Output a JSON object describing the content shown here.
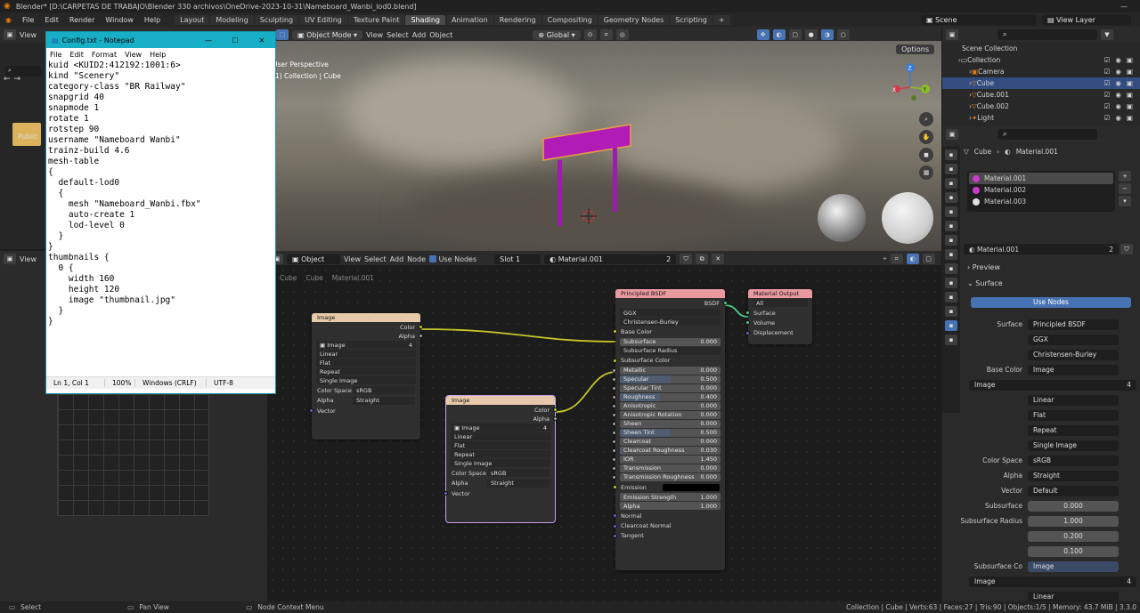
{
  "window_title": "Blender* [D:\\CARPETAS DE TRABAJO\\Blender 330 archivos\\OneDrive-2023-10-31\\Nameboard_Wanbi_lod0.blend]",
  "menu": [
    "File",
    "Edit",
    "Render",
    "Window",
    "Help"
  ],
  "workspaces": [
    "Layout",
    "Modeling",
    "Sculpting",
    "UV Editing",
    "Texture Paint",
    "Shading",
    "Animation",
    "Rendering",
    "Compositing",
    "Geometry Nodes",
    "Scripting",
    "+"
  ],
  "active_workspace": "Shading",
  "scene": "Scene",
  "view_layer": "View Layer",
  "viewport": {
    "mode": "Object Mode",
    "view": "View",
    "select": "Select",
    "add": "Add",
    "object": "Object",
    "orientation": "Global",
    "options": "Options",
    "info1": "User Perspective",
    "info2": "(1) Collection | Cube"
  },
  "gizmo": {
    "z": "Z",
    "y": "Y",
    "x": "X"
  },
  "left_panel": {
    "view": "View",
    "public": "Public"
  },
  "node_editor": {
    "type": "Object",
    "view": "View",
    "select": "Select",
    "add": "Add",
    "node": "Node",
    "use_nodes": "Use Nodes",
    "slot": "Slot 1",
    "material": "Material.001",
    "users": "2",
    "crumb1": "Cube",
    "crumb2": "Cube",
    "crumb3": "Material.001"
  },
  "node_image1": {
    "title": "Image",
    "out_color": "Color",
    "out_alpha": "Alpha",
    "img": "Image",
    "users": "4",
    "interp": "Linear",
    "proj": "Flat",
    "ext": "Repeat",
    "src": "Single Image",
    "cs_lbl": "Color Space",
    "cs": "sRGB",
    "alpha_lbl": "Alpha",
    "alpha": "Straight",
    "vector": "Vector"
  },
  "node_image2": {
    "title": "Image",
    "out_color": "Color",
    "out_alpha": "Alpha",
    "img": "Image",
    "users": "4",
    "interp": "Linear",
    "proj": "Flat",
    "ext": "Repeat",
    "src": "Single Image",
    "cs_lbl": "Color Space",
    "cs": "sRGB",
    "alpha_lbl": "Alpha",
    "alpha": "Straight",
    "vector": "Vector"
  },
  "bsdf": {
    "title": "Principled BSDF",
    "out": "BSDF",
    "dist": "GGX",
    "sss": "Christensen-Burley",
    "base_color": "Base Color",
    "subsurface": "Subsurface",
    "subsurface_v": "0.000",
    "sss_radius": "Subsurface Radius",
    "sss_color": "Subsurface Color",
    "params": [
      {
        "n": "Metallic",
        "v": "0.000",
        "f": 0
      },
      {
        "n": "Specular",
        "v": "0.500",
        "f": 0.5
      },
      {
        "n": "Specular Tint",
        "v": "0.000",
        "f": 0
      },
      {
        "n": "Roughness",
        "v": "0.400",
        "f": 0.4
      },
      {
        "n": "Anisotropic",
        "v": "0.000",
        "f": 0
      },
      {
        "n": "Anisotropic Rotation",
        "v": "0.000",
        "f": 0
      },
      {
        "n": "Sheen",
        "v": "0.000",
        "f": 0
      },
      {
        "n": "Sheen Tint",
        "v": "0.500",
        "f": 0.5
      },
      {
        "n": "Clearcoat",
        "v": "0.000",
        "f": 0
      },
      {
        "n": "Clearcoat Roughness",
        "v": "0.030",
        "f": 0.03
      },
      {
        "n": "IOR",
        "v": "1.450",
        "f": 0
      },
      {
        "n": "Transmission",
        "v": "0.000",
        "f": 0
      },
      {
        "n": "Transmission Roughness",
        "v": "0.000",
        "f": 0
      }
    ],
    "emission": "Emission",
    "emission_strength": "Emission Strength",
    "emission_strength_v": "1.000",
    "alpha": "Alpha",
    "alpha_v": "1.000",
    "normal": "Normal",
    "cc_normal": "Clearcoat Normal",
    "tangent": "Tangent"
  },
  "matout": {
    "title": "Material Output",
    "target": "All",
    "surface": "Surface",
    "volume": "Volume",
    "displacement": "Displacement"
  },
  "outliner": {
    "title": "Scene Collection",
    "items": [
      {
        "n": "Collection",
        "d": 0
      },
      {
        "n": "Camera",
        "d": 1
      },
      {
        "n": "Cube",
        "d": 1
      },
      {
        "n": "Cube.001",
        "d": 1
      },
      {
        "n": "Cube.002",
        "d": 1
      },
      {
        "n": "Light",
        "d": 1
      }
    ]
  },
  "props": {
    "object": "Cube",
    "material": "Material.001",
    "slots": [
      "Material.001",
      "Material.002",
      "Material.003"
    ],
    "mat_field": "Material.001",
    "users": "2",
    "preview": "Preview",
    "surface_panel": "Surface",
    "use_nodes": "Use Nodes",
    "rows": [
      {
        "l": "Surface",
        "v": "Principled BSDF"
      },
      {
        "l": "",
        "v": "GGX"
      },
      {
        "l": "",
        "v": "Christensen-Burley"
      },
      {
        "l": "Base Color",
        "v": "Image"
      }
    ],
    "img": "Image",
    "img_users": "4",
    "img_rows": [
      "Linear",
      "Flat",
      "Repeat",
      "Single Image"
    ],
    "cs_lbl": "Color Space",
    "cs": "sRGB",
    "alpha_lbl": "Alpha",
    "alpha": "Straight",
    "vector_lbl": "Vector",
    "vector": "Default",
    "sub_lbl": "Subsurface",
    "sub": "0.000",
    "sr_lbl": "Subsurface Radius",
    "sr": [
      "1.000",
      "0.200",
      "0.100"
    ],
    "sc_lbl": "Subsurface Co",
    "sc": "Image",
    "img2": "Image",
    "img2_users": "4",
    "linear2": "Linear"
  },
  "notepad": {
    "title": "Config.txt - Notepad",
    "menu": [
      "File",
      "Edit",
      "Format",
      "View",
      "Help"
    ],
    "text": "kuid <KUID2:412192:1001:6>\nkind \"Scenery\"\ncategory-class \"BR Railway\"\nsnapgrid 40\nsnapmode 1\nrotate 1\nrotstep 90\nusername \"Nameboard Wanbi\"\ntrainz-build 4.6\nmesh-table\n{\n  default-lod0\n  {\n    mesh \"Nameboard_Wanbi.fbx\"\n    auto-create 1\n    lod-level 0\n  }\n}\nthumbnails {\n  0 {\n    width 160\n    height 120\n    image \"thumbnail.jpg\"\n  }\n}",
    "pos": "Ln 1, Col 1",
    "zoom": "100%",
    "eol": "Windows (CRLF)",
    "enc": "UTF-8"
  },
  "status": {
    "select": "Select",
    "pan": "Pan View",
    "ctx": "Node Context Menu",
    "stats": "Collection | Cube | Verts:63 | Faces:27 | Tris:90 | Objects:1/5 | Memory: 43.7 MiB | 3.3.0"
  },
  "colors": {
    "accent": "#4772b3",
    "orange": "#e87d0d",
    "notepad_title": "#18aec6"
  }
}
